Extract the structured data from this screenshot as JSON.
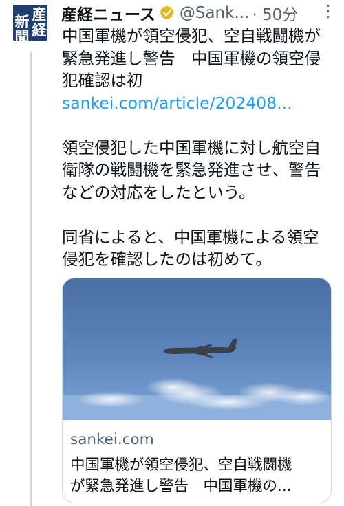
{
  "tweet": {
    "author_name": "産経ニュース",
    "author_handle": "@Sank...",
    "time": "· 50分",
    "avatar_chars": [
      "産",
      "経",
      "新聞"
    ],
    "body_lines": [
      "中国軍機が領空侵犯、空自戦闘機が",
      "緊急発進し警告　中国軍機の領空侵",
      "犯確認は初"
    ],
    "link_text": "sankei.com/article/202408...",
    "paragraph2": [
      "領空侵犯した中国軍機に対し航空自",
      "衛隊の戦闘機を緊急発進させ、警告",
      "などの対応をしたという。"
    ],
    "paragraph3": [
      "同省によると、中国軍機による領空",
      "侵犯を確認したのは初めて。"
    ]
  },
  "card": {
    "domain": "sankei.com",
    "title_lines": [
      "中国軍機が領空侵犯、空自戦闘機",
      "が緊急発進し警告　中国軍機の..."
    ]
  },
  "icons": {
    "verified": "verified-badge-icon",
    "more": "more-icon"
  },
  "colors": {
    "link": "#1d9bf0",
    "secondary_text": "#536471",
    "verified_gold": "#e2b719",
    "avatar_bg": "#1f3f73"
  }
}
